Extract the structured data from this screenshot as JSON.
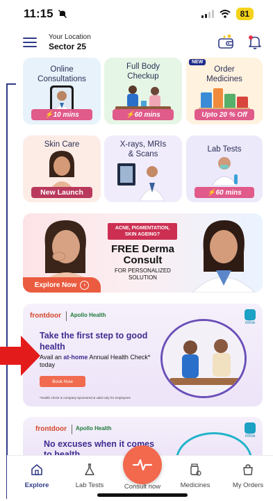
{
  "status_bar": {
    "time": "11:15",
    "battery": "81"
  },
  "header": {
    "location_label": "Your Location",
    "location_value": "Sector 25"
  },
  "tiles": [
    {
      "title": "Online\nConsultations",
      "badge": "⚡10 mins",
      "bg": "#e7f2fb",
      "badge_color": "#e05a8a"
    },
    {
      "title": "Full Body\nCheckup",
      "badge": "⚡60 mins",
      "bg": "#e6f6e6",
      "badge_color": "#e05a8a"
    },
    {
      "title": "Order\nMedicines",
      "badge": "Upto 20 % Off",
      "new_tag": "NEW",
      "bg": "#fff2df",
      "badge_color": "#e05a8a"
    },
    {
      "title": "Skin Care",
      "badge": "New Launch",
      "bg": "#fdece6",
      "badge_color": "#b9395d"
    },
    {
      "title": "X-rays, MRIs\n& Scans",
      "badge": "",
      "bg": "#f1ecfb",
      "badge_color": "#e05a8a"
    },
    {
      "title": "Lab Tests",
      "badge": "⚡60 mins",
      "bg": "#ece9fb",
      "badge_color": "#e05a8a"
    }
  ],
  "derma_banner": {
    "tag": "ACNE, PIGMENTATION, SKIN AGEING?",
    "title": "FREE Derma Consult",
    "subtitle": "FOR PERSONALIZED SOLUTION",
    "cta": "Explore Now"
  },
  "frontdoor_card": {
    "brand": "frontdoor",
    "partner": "Apollo Health",
    "mfine": "mfine",
    "title": "Take the first step to good health",
    "sub_prefix": "Avail an ",
    "sub_highlight": "at-home",
    "sub_suffix": " Annual Health Check* today",
    "button": "Book Now",
    "note": "*Health check is company-sponsored & valid only for employees"
  },
  "frontdoor_card2": {
    "brand": "frontdoor",
    "partner": "Apollo Health",
    "mfine": "mfine",
    "title": "No excuses when it comes to health"
  },
  "bottom_nav": [
    {
      "label": "Explore",
      "icon": "home-icon",
      "active": true
    },
    {
      "label": "Lab Tests",
      "icon": "flask-icon",
      "active": false
    },
    {
      "label": "Consult now",
      "icon": "heartbeat-icon",
      "active": false
    },
    {
      "label": "Medicines",
      "icon": "medicine-icon",
      "active": false
    },
    {
      "label": "My Orders",
      "icon": "bag-icon",
      "active": false
    }
  ],
  "colors": {
    "primary": "#2f3a86",
    "accent": "#f2694e",
    "arrow": "#e41b1b"
  }
}
